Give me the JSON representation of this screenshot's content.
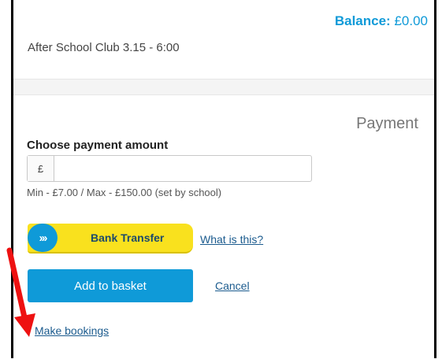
{
  "balance": {
    "label": "Balance:",
    "value": "£0.00"
  },
  "club": {
    "name": "After School Club 3.15 - 6:00"
  },
  "payment": {
    "title": "Payment",
    "choose_label": "Choose payment amount",
    "currency_prefix": "£",
    "amount_value": "",
    "limits": "Min - £7.00 / Max - £150.00 (set by school)"
  },
  "bank_transfer": {
    "label": "Bank Transfer",
    "icon": "chevrons-right-icon",
    "help_link": "What is this?"
  },
  "actions": {
    "add_to_basket": "Add to basket",
    "cancel": "Cancel",
    "make_bookings": "Make bookings"
  },
  "colors": {
    "accent": "#0f9ad8",
    "bank_yellow": "#f9e11e",
    "arrow": "#ee1111"
  }
}
